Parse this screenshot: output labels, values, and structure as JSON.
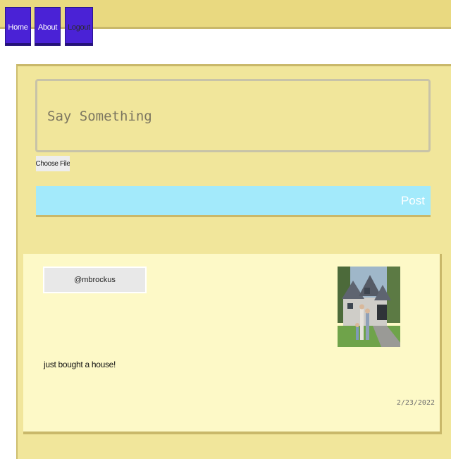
{
  "nav": {
    "home_label": "Home",
    "about_label": "About",
    "logout_label": "Logout"
  },
  "compose": {
    "placeholder": "Say Something",
    "choose_file_label": "Choose File",
    "post_label": "Post"
  },
  "post": {
    "username": "@mbrockus",
    "text": "just bought a house!",
    "date": "2/23/2022"
  },
  "colors": {
    "topbar": "#e9d980",
    "nav_button": "#4a22d6",
    "panel": "#f1e69b",
    "post_button": "#a3eafb",
    "card": "#fdf9c7"
  }
}
